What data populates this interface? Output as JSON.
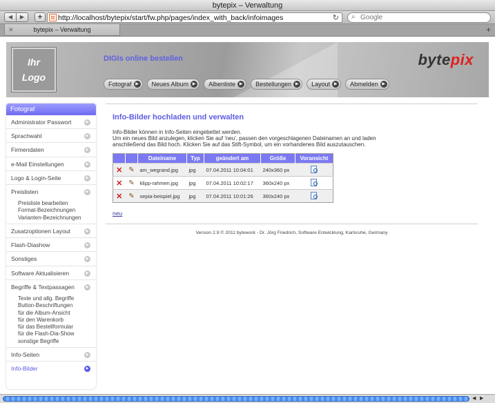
{
  "window": {
    "title": "bytepix – Verwaltung",
    "url": "http://localhost/bytepix/start/fw.php/pages/index_with_back/infoimages",
    "search_placeholder": "Google",
    "tab_label": "bytepix – Verwaltung"
  },
  "header": {
    "logo_line1": "Ihr",
    "logo_line2": "Logo",
    "title": "DIGIs online bestellen",
    "brand_part1": "byte",
    "brand_part2": "pix",
    "nav": [
      "Fotograf",
      "Neues Album",
      "Albenliste",
      "Bestellungen",
      "Layout",
      "Abmelden"
    ]
  },
  "sidebar": {
    "heading": "Fotograf",
    "sections": [
      {
        "label": "Administrator Passwort"
      },
      {
        "label": "Sprachwahl"
      },
      {
        "label": "Firmendaten"
      },
      {
        "label": "e-Mail Einstellungen"
      },
      {
        "label": "Logo & Login-Seite"
      },
      {
        "label": "Preislisten",
        "sub": [
          "Preisliste bearbeiten",
          "Format-Bezeichnungen",
          "Varianten-Bezeichnungen"
        ]
      },
      {
        "label": "Zusatzoptionen Layout"
      },
      {
        "label": "Flash-Diashow"
      },
      {
        "label": "Sonstiges"
      },
      {
        "label": "Software Aktualisieren"
      },
      {
        "label": "Begriffe & Textpassagen",
        "sub": [
          "Texte und allg. Begriffe",
          "Button-Beschriftungen",
          "für die Album-Ansicht",
          "für den Warenkorb",
          "für das Bestellformular",
          "für die Flash-Dia-Show",
          "sonstige Begriffe"
        ]
      },
      {
        "label": "Info-Seiten"
      },
      {
        "label": "Info-Bilder",
        "active": true
      }
    ]
  },
  "main": {
    "title": "Info-Bilder hochladen und verwalten",
    "intro_line1": "Info-Bilder können in Info-Seiten eingebettet werden.",
    "intro_line2": "Um ein neues Bild anzulegen, klicken Sie auf 'neu', passen den vorgeschlagenen Dateinamen an und laden anschließend das Bild hoch. Klicken Sie auf das Stift-Symbol, um ein vorhandenes Bild auszutauschen.",
    "columns": [
      "Dateiname",
      "Typ",
      "geändert am",
      "Größe",
      "Voransicht"
    ],
    "rows": [
      {
        "file": "am_wegrand.jpg",
        "type": "jpg",
        "changed": "07.04.2011 10:04:01",
        "size": "240x360 px"
      },
      {
        "file": "klipp-rahmen.jpg",
        "type": "jpg",
        "changed": "07.04.2011 10:02:17",
        "size": "360x240 px"
      },
      {
        "file": "sepia-beispiel.jpg",
        "type": "jpg",
        "changed": "07.04.2011 10:01:26",
        "size": "360x240 px"
      }
    ],
    "new_link": "neu",
    "footer": "Version 2.9 © 2011 bytework - Dr. Jörg Friedrich, Software Entwicklung, Karlsruhe, Germany"
  },
  "icons": {
    "delete": "cross-icon",
    "edit": "pencil-icon",
    "preview": "magnifier-document-icon"
  }
}
